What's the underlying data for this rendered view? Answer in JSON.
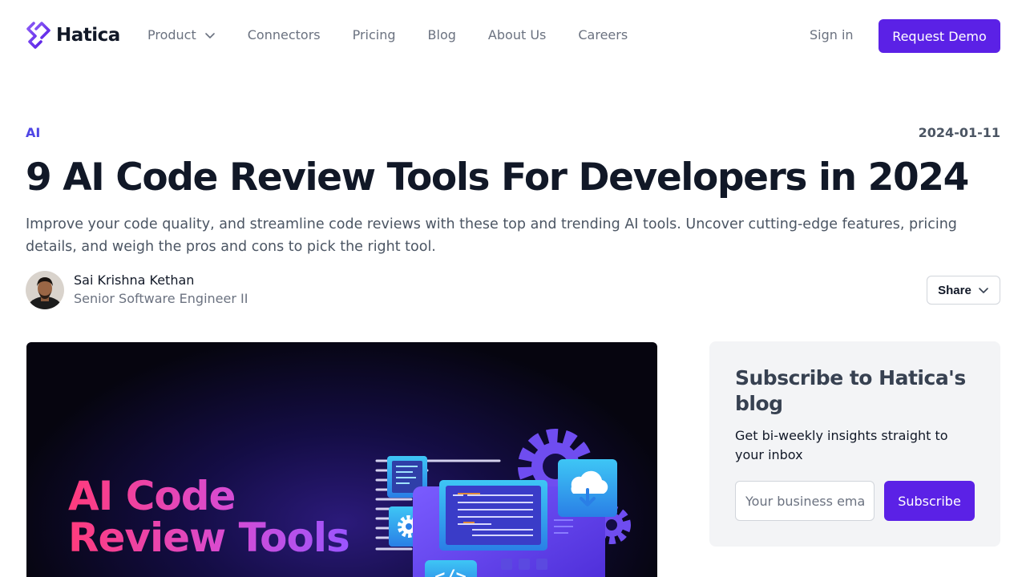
{
  "header": {
    "logo_text": "Hatica",
    "nav": [
      {
        "label": "Product",
        "has_dropdown": true
      },
      {
        "label": "Connectors"
      },
      {
        "label": "Pricing"
      },
      {
        "label": "Blog"
      },
      {
        "label": "About Us"
      },
      {
        "label": "Careers"
      }
    ],
    "signin_label": "Sign in",
    "demo_label": "Request Demo"
  },
  "article": {
    "category": "AI",
    "date": "2024-01-11",
    "title": "9 AI Code Review Tools For Developers in 2024",
    "subtitle": "Improve your code quality, and streamline code reviews with these top and trending AI tools. Uncover cutting-edge features, pricing details, and weigh the pros and cons to pick the right tool.",
    "author_name": "Sai Krishna Kethan",
    "author_role": "Senior Software Engineer II",
    "share_label": "Share",
    "hero_line1": "AI Code",
    "hero_line2": "Review Tools"
  },
  "subscribe": {
    "title": "Subscribe to Hatica's blog",
    "description": "Get bi-weekly insights straight to your inbox",
    "email_placeholder": "Your business email",
    "button_label": "Subscribe"
  },
  "colors": {
    "accent": "#5b21e6",
    "category": "#4f46e5"
  }
}
